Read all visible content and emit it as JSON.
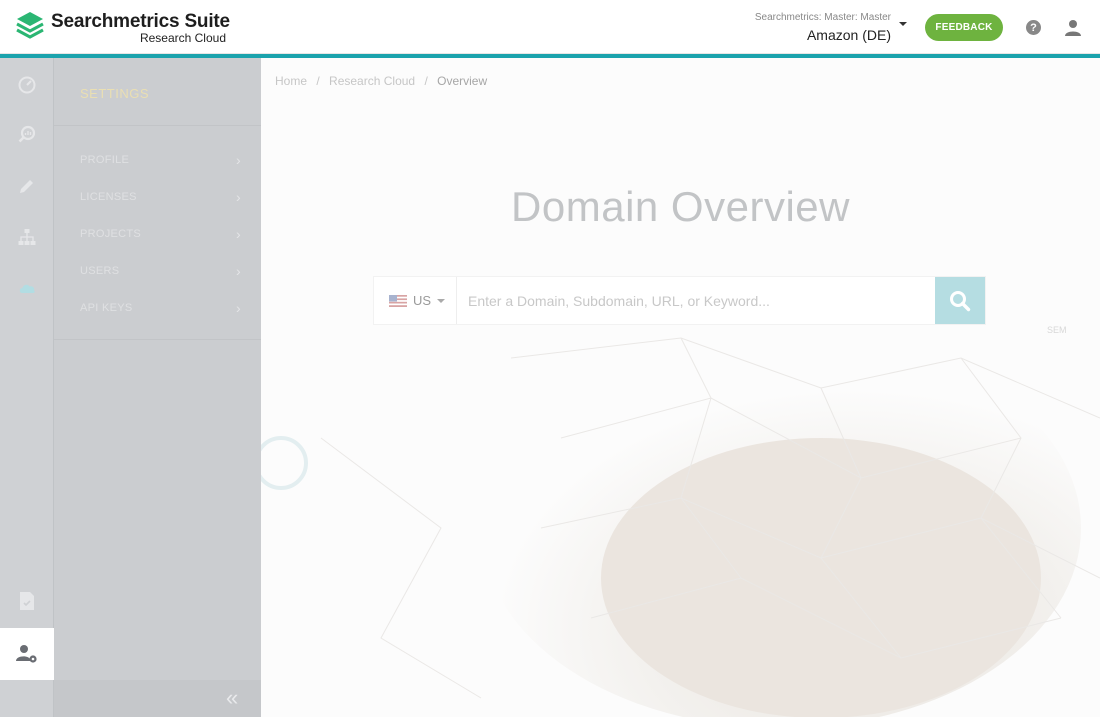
{
  "brand": {
    "title": "Searchmetrics Suite",
    "subtitle": "Research Cloud",
    "logo_icon": "layers-logo-icon",
    "logo_color": "#2bb673"
  },
  "account": {
    "label": "Searchmetrics: Master: Master",
    "name": "Amazon (DE)"
  },
  "header": {
    "feedback_label": "FEEDBACK",
    "help_label": "?",
    "accent_color": "#1ba3ad",
    "feedback_color": "#6eb33f"
  },
  "rail": {
    "items": [
      {
        "icon": "speedometer-icon"
      },
      {
        "icon": "magnifier-chart-icon"
      },
      {
        "icon": "pencil-icon"
      },
      {
        "icon": "sitemap-icon"
      },
      {
        "icon": "cloud-icon"
      }
    ],
    "bottom_items": [
      {
        "icon": "document-icon"
      },
      {
        "icon": "user-settings-icon"
      }
    ]
  },
  "settings": {
    "title": "SETTINGS",
    "items": [
      {
        "label": "PROFILE"
      },
      {
        "label": "LICENSES"
      },
      {
        "label": "PROJECTS"
      },
      {
        "label": "USERS"
      },
      {
        "label": "API KEYS"
      }
    ],
    "chevron": "›",
    "collapse_label": "«"
  },
  "breadcrumb": {
    "items": [
      "Home",
      "Research Cloud",
      "Overview"
    ],
    "separator": "/"
  },
  "main": {
    "title": "Domain Overview",
    "country_code": "US",
    "search_placeholder": "Enter a Domain, Subdomain, URL, or Keyword...",
    "search_value": "",
    "tiny_label": "SEM"
  }
}
